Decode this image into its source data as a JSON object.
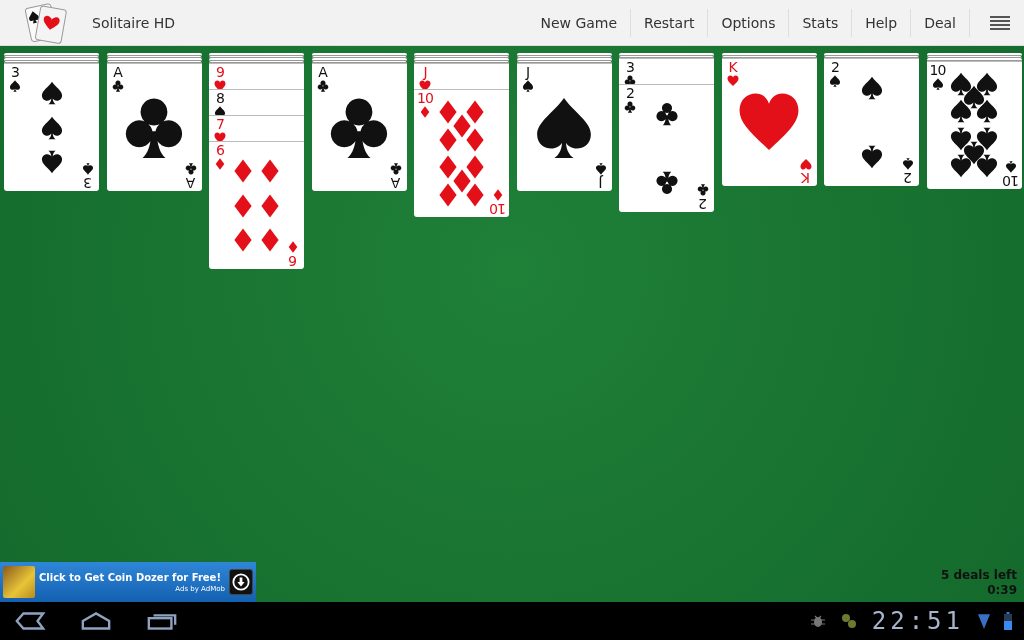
{
  "app": {
    "title": "Solitaire HD"
  },
  "menu": [
    "New Game",
    "Restart",
    "Options",
    "Stats",
    "Help",
    "Deal"
  ],
  "tableau": [
    {
      "cards": [
        {
          "face_up": false
        },
        {
          "face_up": false
        },
        {
          "face_up": false
        },
        {
          "face_up": false
        },
        {
          "face_up": true,
          "rank": "3",
          "kind": "spades",
          "bottom_rank": "3"
        }
      ]
    },
    {
      "cards": [
        {
          "face_up": false
        },
        {
          "face_up": false
        },
        {
          "face_up": false
        },
        {
          "face_up": false
        },
        {
          "face_up": true,
          "rank": "A",
          "kind": "clubs",
          "bottom_rank": "A"
        }
      ]
    },
    {
      "cards": [
        {
          "face_up": false
        },
        {
          "face_up": false
        },
        {
          "face_up": false
        },
        {
          "face_up": false
        },
        {
          "face_up": true,
          "rank": "9",
          "kind": "hearts"
        },
        {
          "face_up": true,
          "rank": "8",
          "kind": "spades"
        },
        {
          "face_up": true,
          "rank": "7",
          "kind": "hearts"
        },
        {
          "face_up": true,
          "rank": "6",
          "kind": "diamonds",
          "bottom_rank": "6"
        }
      ]
    },
    {
      "cards": [
        {
          "face_up": false
        },
        {
          "face_up": false
        },
        {
          "face_up": false
        },
        {
          "face_up": false
        },
        {
          "face_up": true,
          "rank": "A",
          "kind": "clubs",
          "bottom_rank": "A"
        }
      ]
    },
    {
      "cards": [
        {
          "face_up": false
        },
        {
          "face_up": false
        },
        {
          "face_up": false
        },
        {
          "face_up": false
        },
        {
          "face_up": true,
          "rank": "J",
          "kind": "hearts"
        },
        {
          "face_up": true,
          "rank": "10",
          "kind": "diamonds",
          "bottom_rank": "10"
        }
      ]
    },
    {
      "cards": [
        {
          "face_up": false
        },
        {
          "face_up": false
        },
        {
          "face_up": false
        },
        {
          "face_up": false
        },
        {
          "face_up": true,
          "rank": "J",
          "kind": "spades",
          "bottom_rank": "J"
        }
      ]
    },
    {
      "cards": [
        {
          "face_up": false
        },
        {
          "face_up": false
        },
        {
          "face_up": true,
          "rank": "3",
          "kind": "clubs"
        },
        {
          "face_up": true,
          "rank": "2",
          "kind": "clubs",
          "bottom_rank": "2"
        }
      ]
    },
    {
      "cards": [
        {
          "face_up": false
        },
        {
          "face_up": false
        },
        {
          "face_up": true,
          "rank": "K",
          "kind": "hearts",
          "bottom_rank": "K"
        }
      ]
    },
    {
      "cards": [
        {
          "face_up": false
        },
        {
          "face_up": false
        },
        {
          "face_up": true,
          "rank": "2",
          "kind": "spades",
          "bottom_rank": "2"
        }
      ]
    },
    {
      "cards": [
        {
          "face_up": false
        },
        {
          "face_up": false
        },
        {
          "face_up": false
        },
        {
          "face_up": true,
          "rank": "10",
          "kind": "spades",
          "bottom_rank": "10"
        }
      ]
    }
  ],
  "ad": {
    "headline": "Click to Get Coin Dozer for Free!",
    "attribution": "Ads by AdMob"
  },
  "game_status": {
    "deals_left": "5 deals left",
    "timer": "0:39"
  },
  "system_bar": {
    "clock": "22:51"
  }
}
